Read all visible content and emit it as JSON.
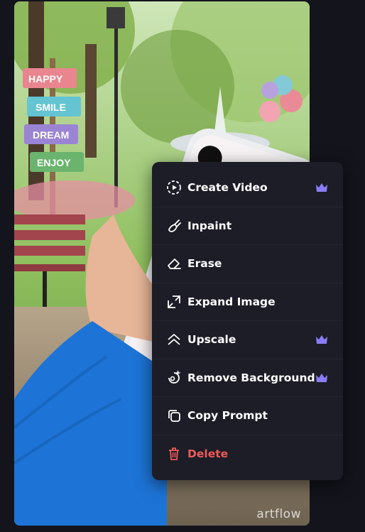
{
  "image": {
    "watermark": "artflow",
    "signs": [
      "HAPPY",
      "SMILE",
      "DREAM",
      "ENJOY"
    ]
  },
  "menu": {
    "items": [
      {
        "label": "Create Video",
        "icon": "video-play-icon",
        "premium": true
      },
      {
        "label": "Inpaint",
        "icon": "brush-icon",
        "premium": false
      },
      {
        "label": "Erase",
        "icon": "eraser-icon",
        "premium": false
      },
      {
        "label": "Expand Image",
        "icon": "expand-icon",
        "premium": false
      },
      {
        "label": "Upscale",
        "icon": "upscale-icon",
        "premium": true
      },
      {
        "label": "Remove Background",
        "icon": "remove-background-icon",
        "premium": true
      },
      {
        "label": "Copy Prompt",
        "icon": "copy-icon",
        "premium": false
      },
      {
        "label": "Delete",
        "icon": "trash-icon",
        "premium": false
      }
    ]
  },
  "colors": {
    "background": "#13141c",
    "menu": "#1c1d26",
    "premium": "#8b7cf6",
    "danger": "#ef5a5a"
  }
}
